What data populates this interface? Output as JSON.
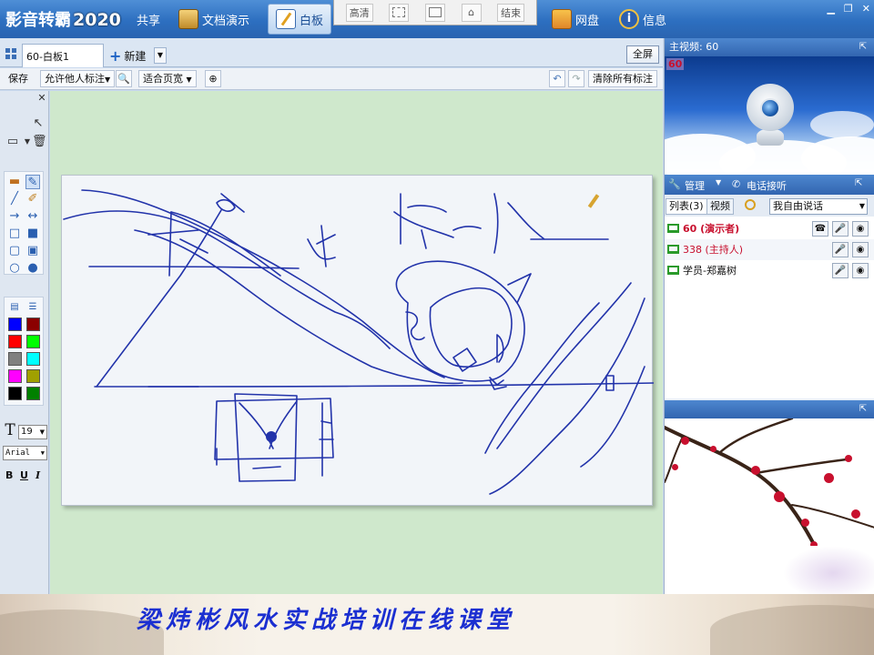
{
  "app": {
    "brand": "影音转霸",
    "brand_year": "2020"
  },
  "topbar": {
    "share_label": "共享",
    "doc_label": "文档演示",
    "whiteboard_label": "白板",
    "disk_label": "网盘",
    "info_label": "信息"
  },
  "float_bar": {
    "quality_label": "高清",
    "end_label": "结束"
  },
  "tabs": {
    "active_tab": "60-白板1",
    "new_label": "新建",
    "fullscreen_label": "全屏"
  },
  "actions": {
    "save_label": "保存",
    "allow_label": "允许他人标注",
    "fit_label": "适合页宽",
    "clear_label": "清除所有标注"
  },
  "tools": {
    "font_size": "19",
    "font_name": "Arial",
    "bold": "B",
    "underline": "U",
    "italic": "I",
    "text_tool": "T",
    "swatches": [
      "#0000ff",
      "#8b0000",
      "#ff0000",
      "#00ff00",
      "#808080",
      "#00ffff",
      "#ff00ff",
      "#a0a000",
      "#000000",
      "#008000"
    ]
  },
  "right": {
    "main_video_label": "主视频: 60",
    "video_tag": "60",
    "manage_label": "管理",
    "phone_label": "电话接听",
    "list_label": "列表(3)",
    "video_tab_label": "视频",
    "speak_mode": "我自由说话",
    "users": [
      {
        "name": "60 (演示者)",
        "color": "#c8102e",
        "bold": true
      },
      {
        "name": "338 (主持人)",
        "color": "#c8102e",
        "bold": false
      },
      {
        "name": "学员-郑嘉树",
        "color": "#111111",
        "bold": false
      }
    ]
  },
  "footer": {
    "banner_text": "梁炜彬风水实战培训在线课堂"
  },
  "colors": {
    "ink": "#2233aa",
    "canvas_bg": "#cfe8cc",
    "accent": "#2d6fc0"
  }
}
